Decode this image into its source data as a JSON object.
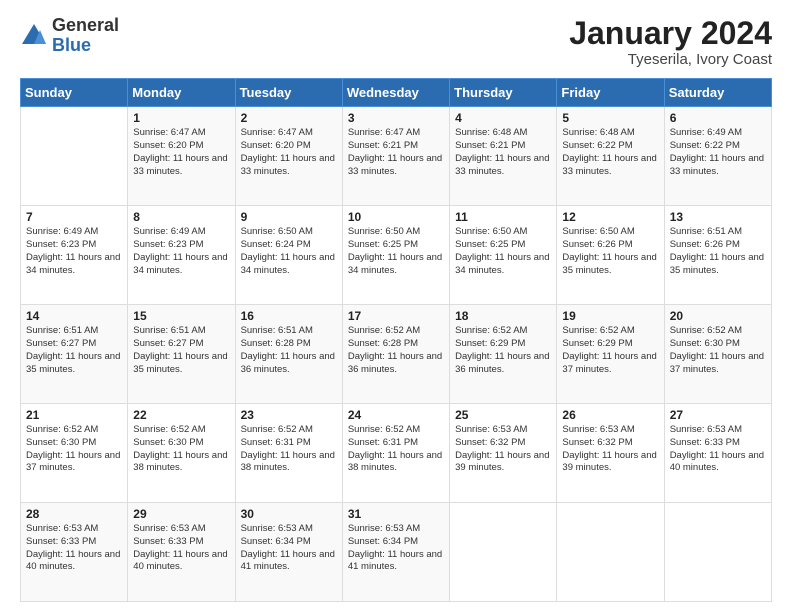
{
  "header": {
    "logo_general": "General",
    "logo_blue": "Blue",
    "main_title": "January 2024",
    "subtitle": "Tyeserila, Ivory Coast"
  },
  "calendar": {
    "days_of_week": [
      "Sunday",
      "Monday",
      "Tuesday",
      "Wednesday",
      "Thursday",
      "Friday",
      "Saturday"
    ],
    "weeks": [
      [
        {
          "day": "",
          "info": ""
        },
        {
          "day": "1",
          "info": "Sunrise: 6:47 AM\nSunset: 6:20 PM\nDaylight: 11 hours and 33 minutes."
        },
        {
          "day": "2",
          "info": "Sunrise: 6:47 AM\nSunset: 6:20 PM\nDaylight: 11 hours and 33 minutes."
        },
        {
          "day": "3",
          "info": "Sunrise: 6:47 AM\nSunset: 6:21 PM\nDaylight: 11 hours and 33 minutes."
        },
        {
          "day": "4",
          "info": "Sunrise: 6:48 AM\nSunset: 6:21 PM\nDaylight: 11 hours and 33 minutes."
        },
        {
          "day": "5",
          "info": "Sunrise: 6:48 AM\nSunset: 6:22 PM\nDaylight: 11 hours and 33 minutes."
        },
        {
          "day": "6",
          "info": "Sunrise: 6:49 AM\nSunset: 6:22 PM\nDaylight: 11 hours and 33 minutes."
        }
      ],
      [
        {
          "day": "7",
          "info": "Sunrise: 6:49 AM\nSunset: 6:23 PM\nDaylight: 11 hours and 34 minutes."
        },
        {
          "day": "8",
          "info": "Sunrise: 6:49 AM\nSunset: 6:23 PM\nDaylight: 11 hours and 34 minutes."
        },
        {
          "day": "9",
          "info": "Sunrise: 6:50 AM\nSunset: 6:24 PM\nDaylight: 11 hours and 34 minutes."
        },
        {
          "day": "10",
          "info": "Sunrise: 6:50 AM\nSunset: 6:25 PM\nDaylight: 11 hours and 34 minutes."
        },
        {
          "day": "11",
          "info": "Sunrise: 6:50 AM\nSunset: 6:25 PM\nDaylight: 11 hours and 34 minutes."
        },
        {
          "day": "12",
          "info": "Sunrise: 6:50 AM\nSunset: 6:26 PM\nDaylight: 11 hours and 35 minutes."
        },
        {
          "day": "13",
          "info": "Sunrise: 6:51 AM\nSunset: 6:26 PM\nDaylight: 11 hours and 35 minutes."
        }
      ],
      [
        {
          "day": "14",
          "info": "Sunrise: 6:51 AM\nSunset: 6:27 PM\nDaylight: 11 hours and 35 minutes."
        },
        {
          "day": "15",
          "info": "Sunrise: 6:51 AM\nSunset: 6:27 PM\nDaylight: 11 hours and 35 minutes."
        },
        {
          "day": "16",
          "info": "Sunrise: 6:51 AM\nSunset: 6:28 PM\nDaylight: 11 hours and 36 minutes."
        },
        {
          "day": "17",
          "info": "Sunrise: 6:52 AM\nSunset: 6:28 PM\nDaylight: 11 hours and 36 minutes."
        },
        {
          "day": "18",
          "info": "Sunrise: 6:52 AM\nSunset: 6:29 PM\nDaylight: 11 hours and 36 minutes."
        },
        {
          "day": "19",
          "info": "Sunrise: 6:52 AM\nSunset: 6:29 PM\nDaylight: 11 hours and 37 minutes."
        },
        {
          "day": "20",
          "info": "Sunrise: 6:52 AM\nSunset: 6:30 PM\nDaylight: 11 hours and 37 minutes."
        }
      ],
      [
        {
          "day": "21",
          "info": "Sunrise: 6:52 AM\nSunset: 6:30 PM\nDaylight: 11 hours and 37 minutes."
        },
        {
          "day": "22",
          "info": "Sunrise: 6:52 AM\nSunset: 6:30 PM\nDaylight: 11 hours and 38 minutes."
        },
        {
          "day": "23",
          "info": "Sunrise: 6:52 AM\nSunset: 6:31 PM\nDaylight: 11 hours and 38 minutes."
        },
        {
          "day": "24",
          "info": "Sunrise: 6:52 AM\nSunset: 6:31 PM\nDaylight: 11 hours and 38 minutes."
        },
        {
          "day": "25",
          "info": "Sunrise: 6:53 AM\nSunset: 6:32 PM\nDaylight: 11 hours and 39 minutes."
        },
        {
          "day": "26",
          "info": "Sunrise: 6:53 AM\nSunset: 6:32 PM\nDaylight: 11 hours and 39 minutes."
        },
        {
          "day": "27",
          "info": "Sunrise: 6:53 AM\nSunset: 6:33 PM\nDaylight: 11 hours and 40 minutes."
        }
      ],
      [
        {
          "day": "28",
          "info": "Sunrise: 6:53 AM\nSunset: 6:33 PM\nDaylight: 11 hours and 40 minutes."
        },
        {
          "day": "29",
          "info": "Sunrise: 6:53 AM\nSunset: 6:33 PM\nDaylight: 11 hours and 40 minutes."
        },
        {
          "day": "30",
          "info": "Sunrise: 6:53 AM\nSunset: 6:34 PM\nDaylight: 11 hours and 41 minutes."
        },
        {
          "day": "31",
          "info": "Sunrise: 6:53 AM\nSunset: 6:34 PM\nDaylight: 11 hours and 41 minutes."
        },
        {
          "day": "",
          "info": ""
        },
        {
          "day": "",
          "info": ""
        },
        {
          "day": "",
          "info": ""
        }
      ]
    ]
  }
}
